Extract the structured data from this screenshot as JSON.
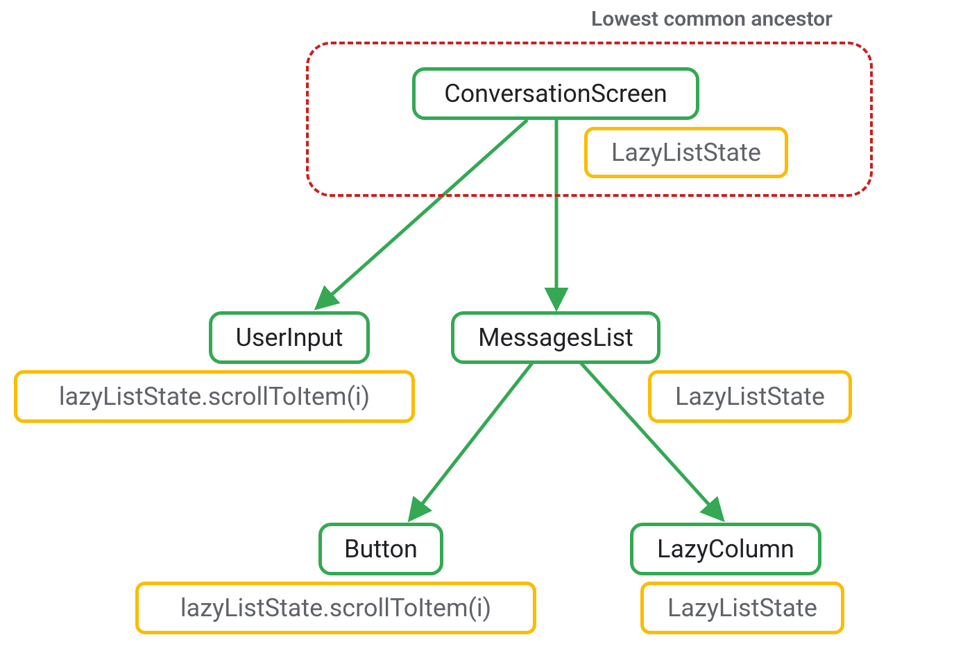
{
  "labels": {
    "ancestor": "Lowest common ancestor"
  },
  "nodes": {
    "conversation_screen": "ConversationScreen",
    "lazy_list_state_top": "LazyListState",
    "user_input": "UserInput",
    "messages_list": "MessagesList",
    "user_input_attach": "lazyListState.scrollToItem(i)",
    "messages_list_attach": "LazyListState",
    "button": "Button",
    "lazy_column": "LazyColumn",
    "button_attach": "lazyListState.scrollToItem(i)",
    "lazy_column_attach": "LazyListState"
  },
  "colors": {
    "green": "#34a853",
    "yellow": "#fbbc04",
    "red": "#c5221f",
    "text_dark": "#202124",
    "text_muted": "#5f6368"
  }
}
